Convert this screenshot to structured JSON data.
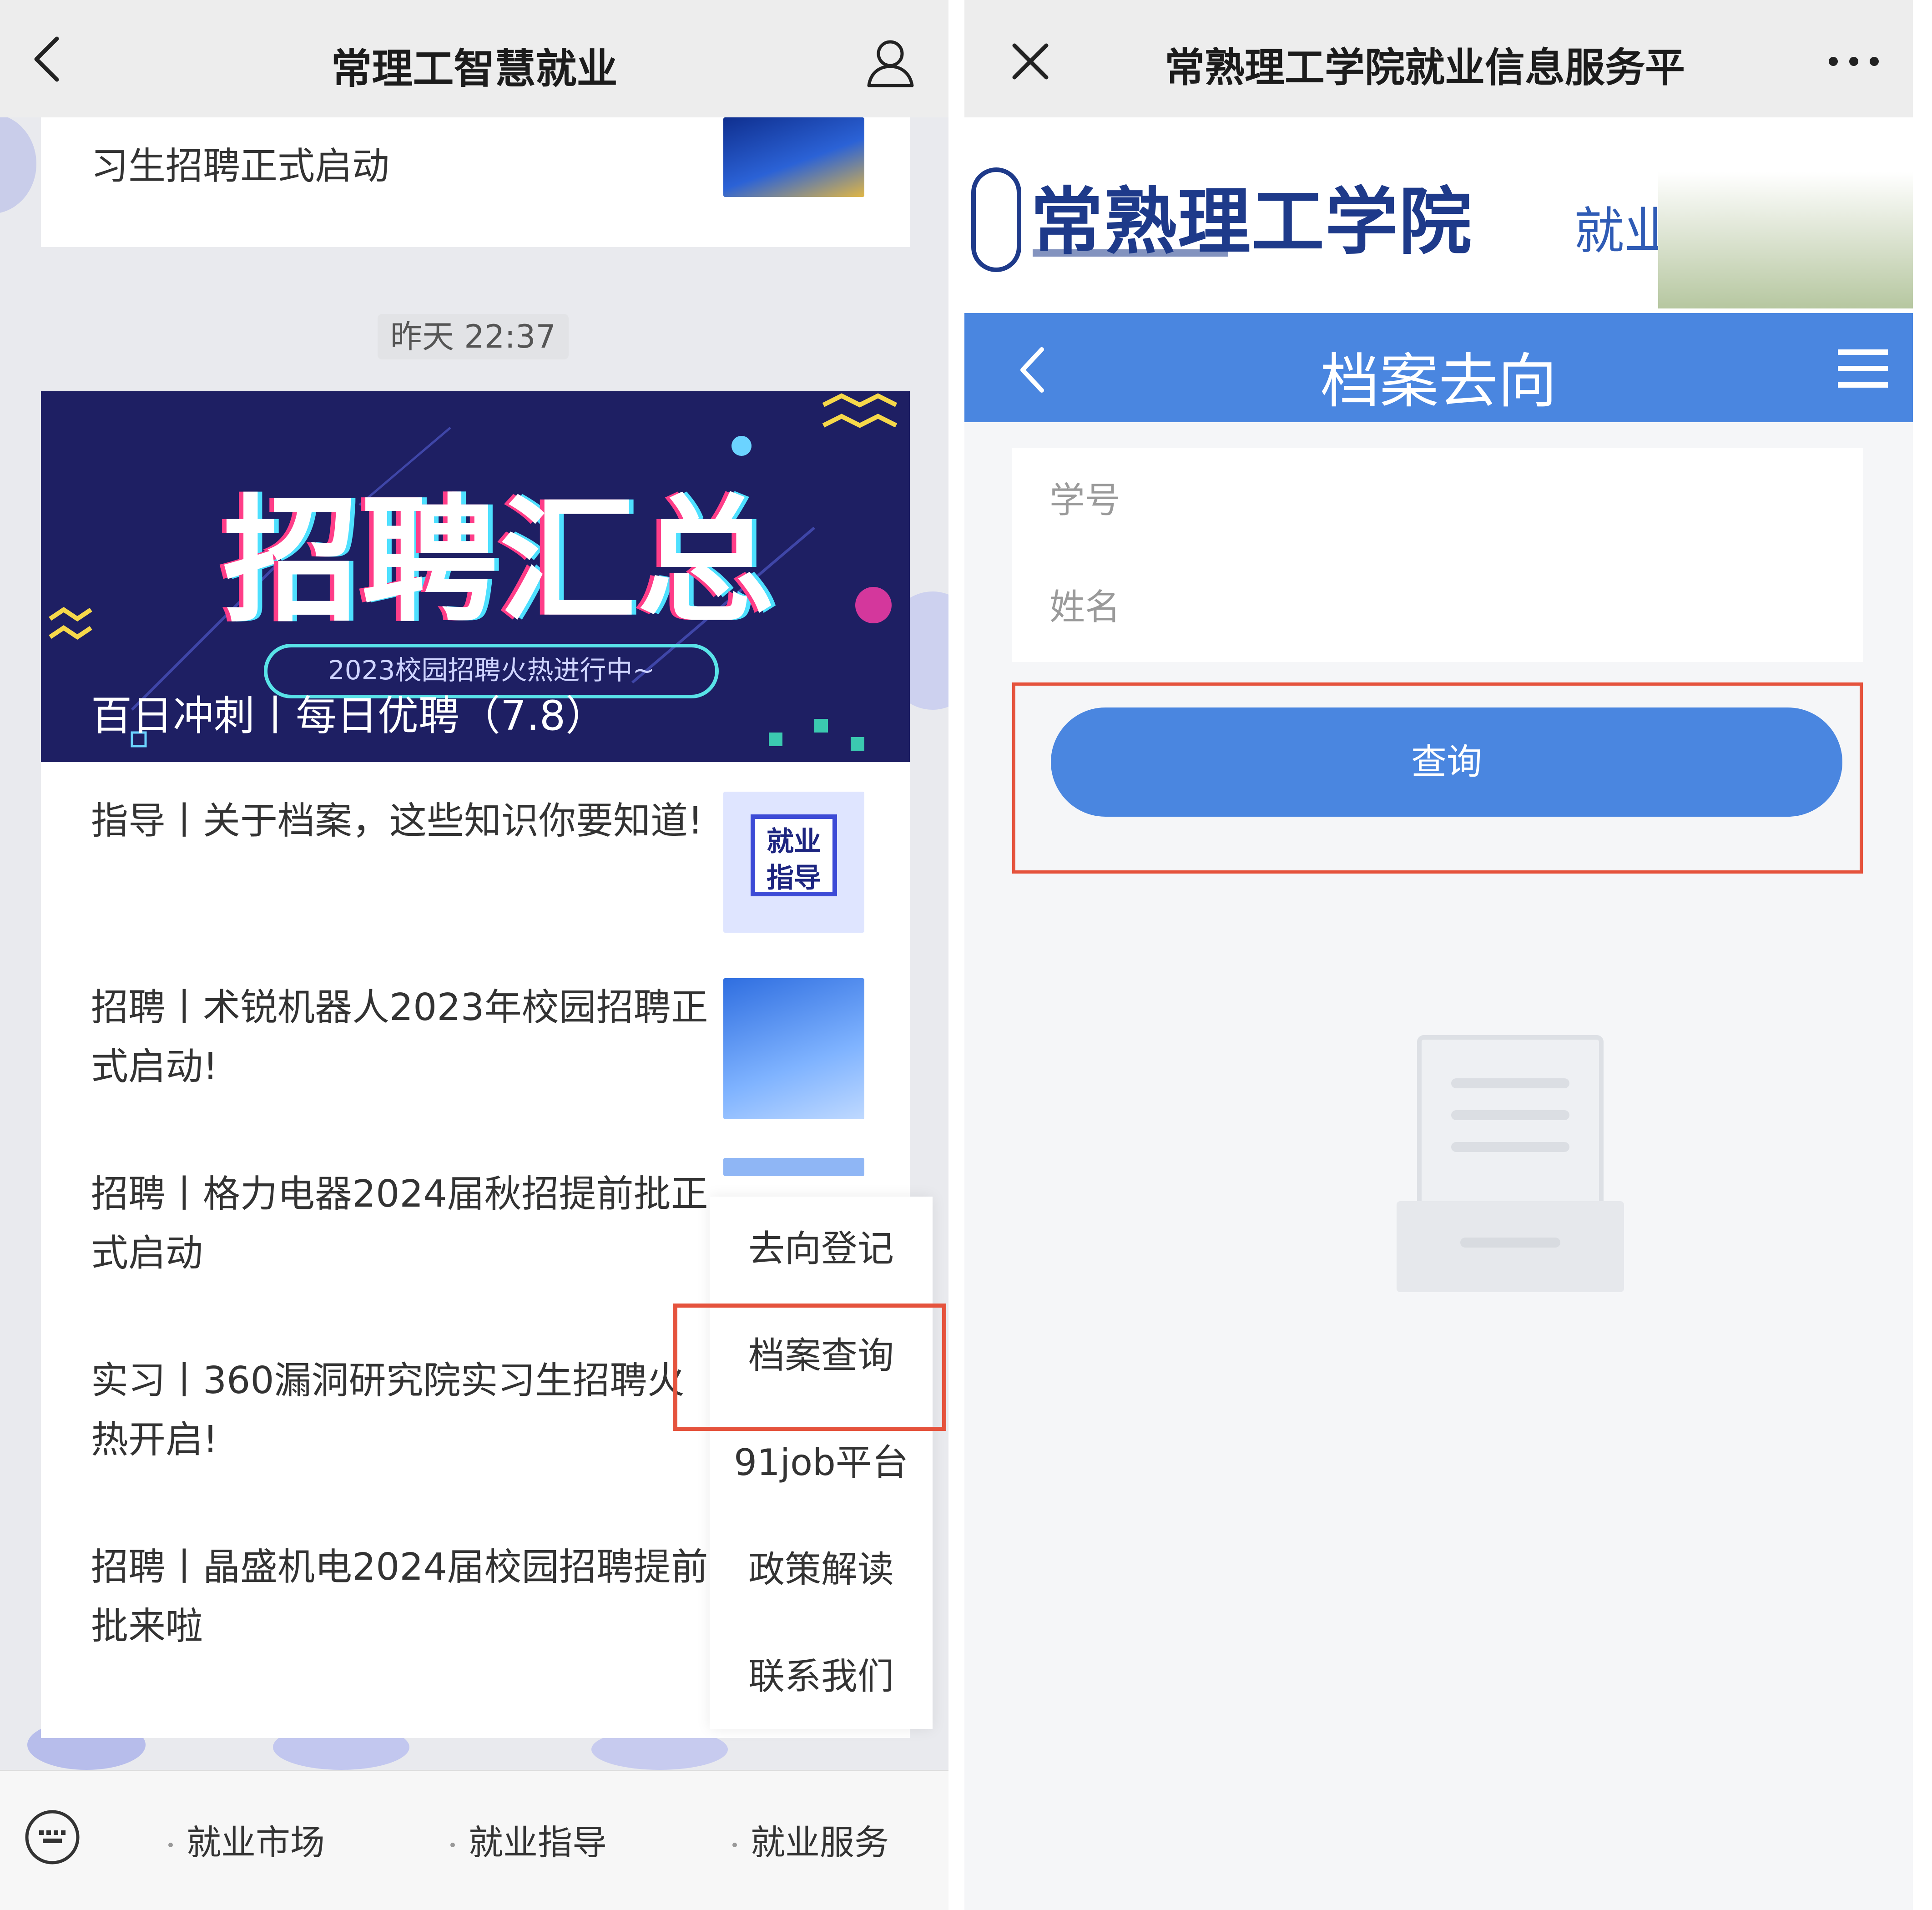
{
  "left_screen": {
    "header": {
      "title": "常理工智慧就业"
    },
    "top_article": {
      "title": "习生招聘正式启动"
    },
    "timestamp": "昨天 22:37",
    "banner": {
      "title": "招聘汇总",
      "pill_text": "2023校园招聘火热进行中~",
      "caption": "百日冲刺丨每日优聘（7.8）"
    },
    "articles": [
      {
        "title": "指导丨关于档案，这些知识你要知道!",
        "thumb_text": "就业\n指导"
      },
      {
        "title": "招聘丨术锐机器人2023年校园招聘正式启动!"
      },
      {
        "title": "招聘丨格力电器2024届秋招提前批正式启动"
      },
      {
        "title": "实习丨360漏洞研究院实习生招聘火热开启!"
      },
      {
        "title": "招聘丨晶盛机电2024届校园招聘提前批来啦"
      }
    ],
    "popup_menu": [
      "去向登记",
      "档案查询",
      "91job平台",
      "政策解读",
      "联系我们"
    ],
    "bottom_menu": [
      "就业市场",
      "就业指导",
      "就业服务"
    ],
    "highlight_color": "#e5533d"
  },
  "right_screen": {
    "header": {
      "title": "常熟理工学院就业信息服务平"
    },
    "site": {
      "logo_text": "常熟理工学院",
      "logo_sub": "就业信息网"
    },
    "nav": {
      "title": "档案去向"
    },
    "form": {
      "student_id_placeholder": "学号",
      "name_placeholder": "姓名"
    },
    "query_button": "查询",
    "accent_color": "#4a86e0"
  },
  "icons": [
    "back-icon",
    "user-icon",
    "close-icon",
    "more-icon",
    "menu-icon",
    "keyboard-icon",
    "document-icon"
  ]
}
